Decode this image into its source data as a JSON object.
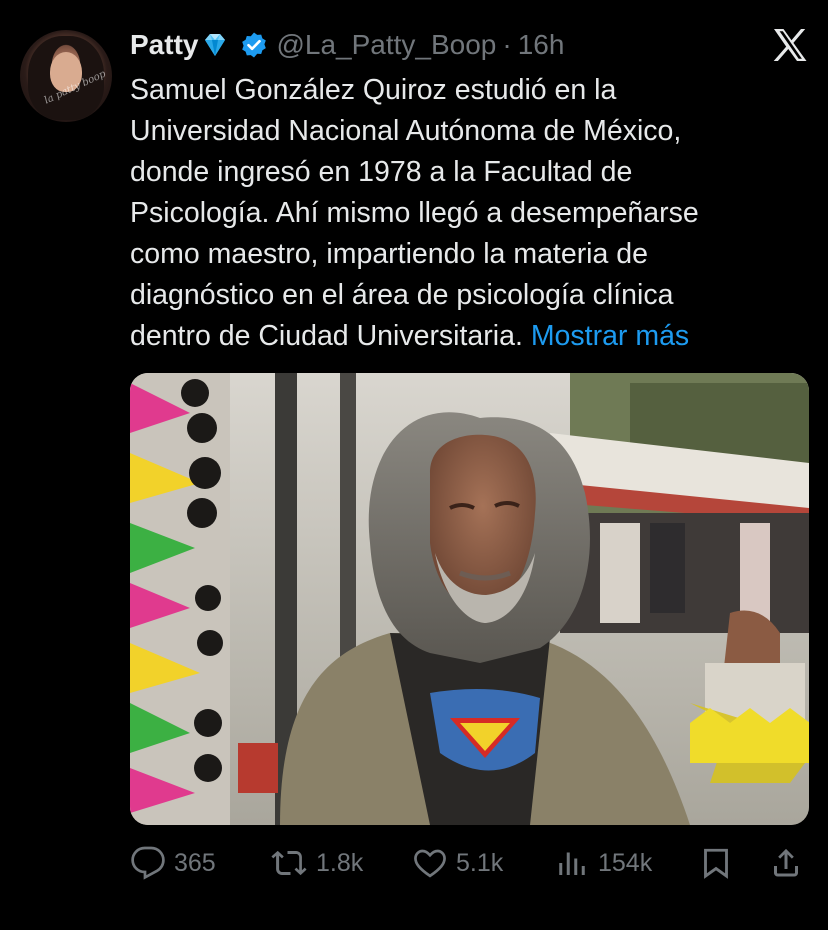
{
  "tweet": {
    "author": {
      "name": "Patty",
      "name_emoji": "gem-emoji",
      "verified": true,
      "handle": "@La_Patty_Boop",
      "avatar_watermark": "la patty boop"
    },
    "separator": "·",
    "time": "16h",
    "text_lines": [
      "Samuel González Quiroz estudió en la",
      "Universidad Nacional Autónoma de México,",
      "donde ingresó en 1978 a la Facultad de",
      "Psicología. Ahí mismo llegó a desempeñarse",
      "como maestro, impartiendo la materia de",
      "diagnóstico en el área de psicología clínica",
      "dentro de Ciudad Universitaria."
    ],
    "show_more": "Mostrar más",
    "media": {
      "description_icon": "photo",
      "accent_color": "#1d9bf0"
    },
    "actions": {
      "replies": {
        "icon": "reply-icon",
        "count": "365"
      },
      "reposts": {
        "icon": "repost-icon",
        "count": "1.8k"
      },
      "likes": {
        "icon": "like-icon",
        "count": "5.1k"
      },
      "views": {
        "icon": "views-icon",
        "count": "154k"
      },
      "bookmark": {
        "icon": "bookmark-icon"
      },
      "share": {
        "icon": "share-icon"
      }
    }
  },
  "colors": {
    "background": "#000000",
    "text": "#e7e9ea",
    "muted": "#71767b",
    "link": "#1d9bf0",
    "verified": "#1d9bf0"
  }
}
